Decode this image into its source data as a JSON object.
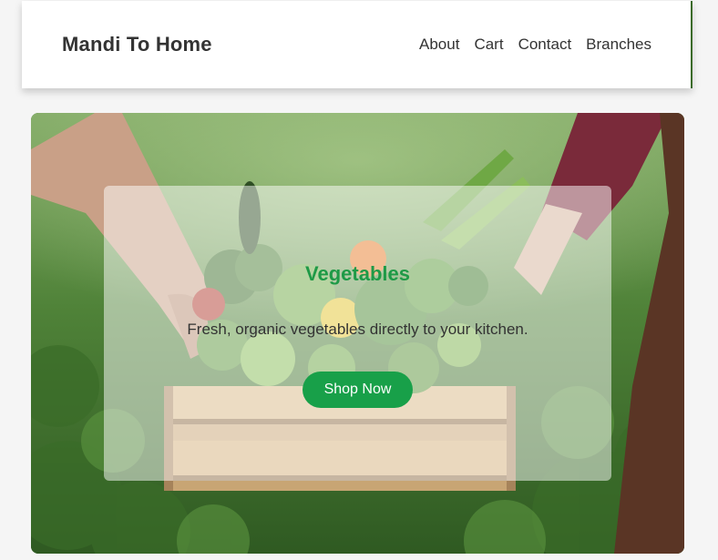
{
  "navbar": {
    "brand": "Mandi To Home",
    "links": [
      {
        "label": "About"
      },
      {
        "label": "Cart"
      },
      {
        "label": "Contact"
      },
      {
        "label": "Branches"
      }
    ]
  },
  "hero": {
    "title": "Vegetables",
    "subtitle": "Fresh, organic vegetables directly to your kitchen.",
    "cta_label": "Shop Now"
  },
  "colors": {
    "accent_green": "#18a049",
    "title_green": "#1f9a47",
    "text_dark": "#333333"
  }
}
